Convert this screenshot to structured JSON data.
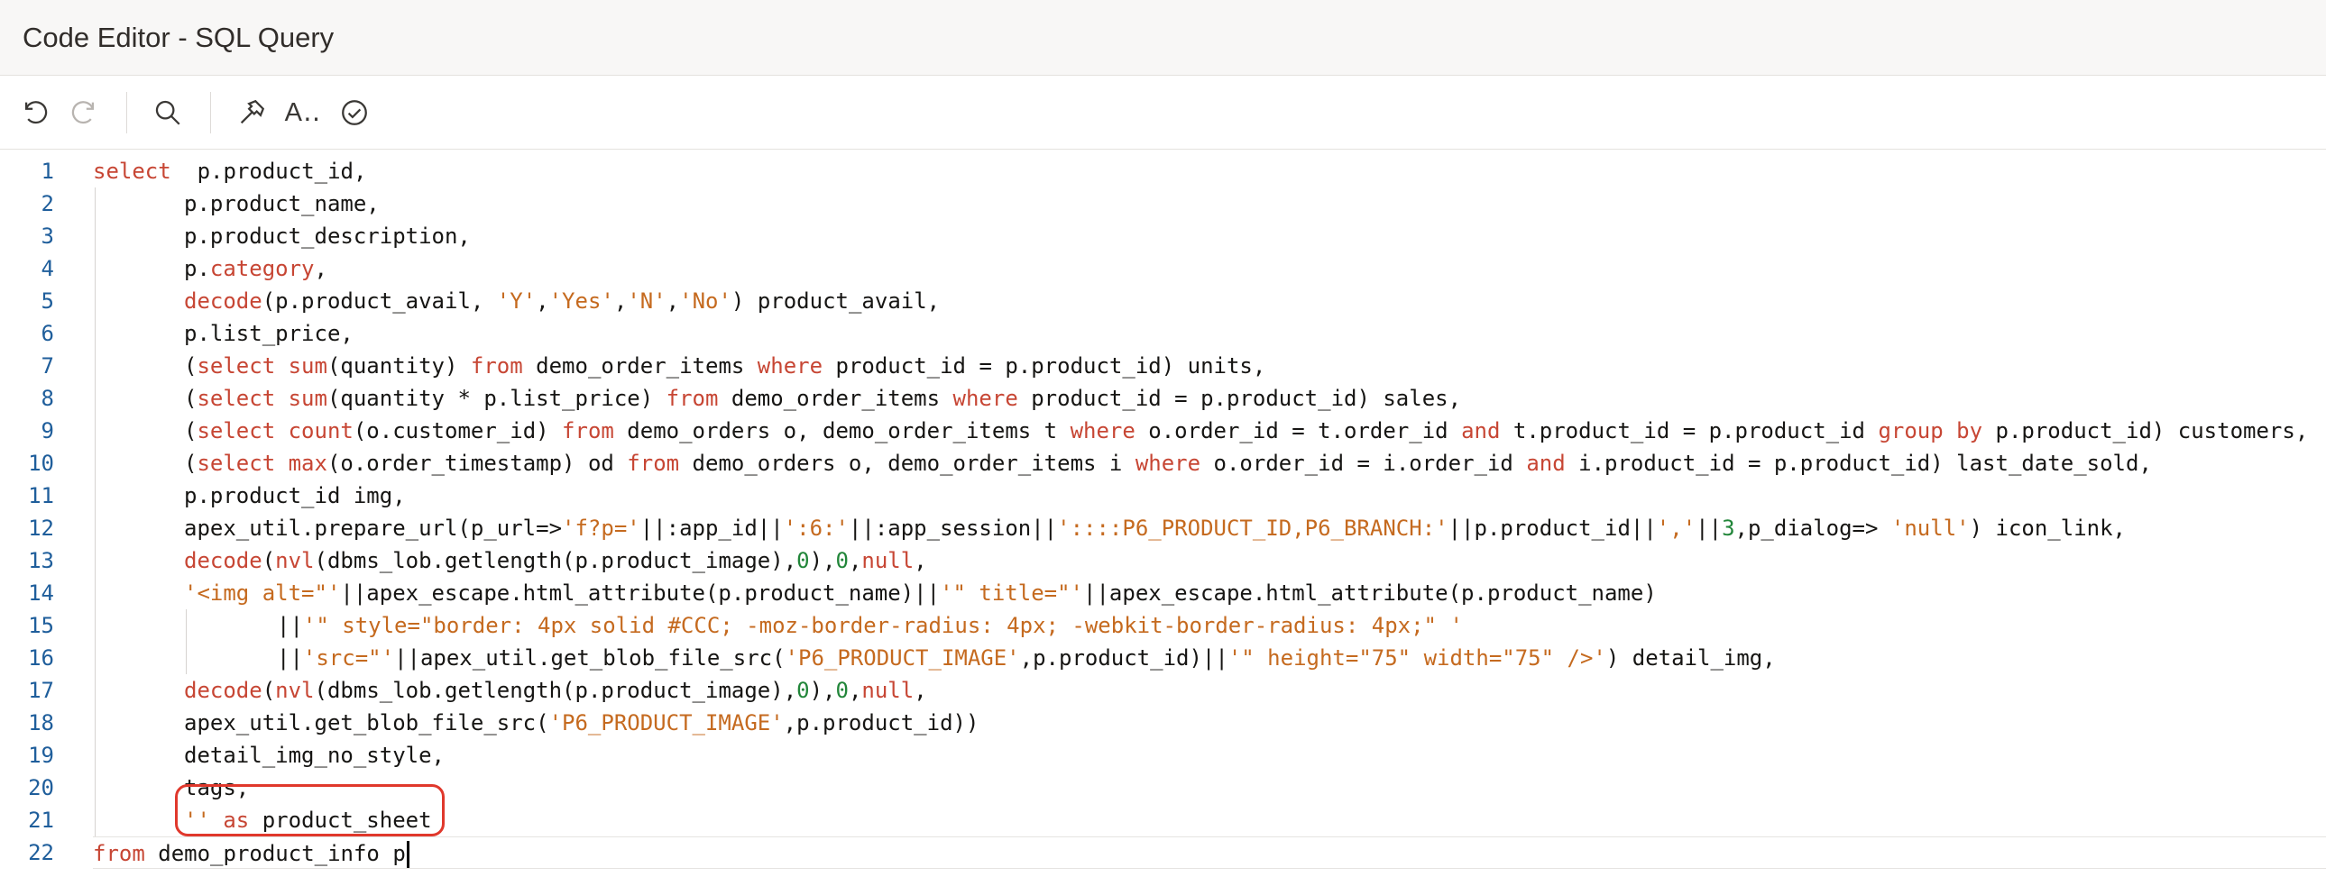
{
  "window": {
    "title": "Code Editor - SQL Query"
  },
  "toolbar": {
    "undo": "undo-icon",
    "redo": "redo-icon",
    "search": "search-icon",
    "settings": "hammer-icon",
    "autocomplete_label": "A‥",
    "validate": "check-circle-icon"
  },
  "highlight_color": "#e0382c",
  "colors": {
    "keyword": "#c74634",
    "string": "#c56a1f",
    "number": "#22863a",
    "line_number": "#1f5e9b"
  },
  "editor": {
    "line_numbers": [
      "1",
      "2",
      "3",
      "4",
      "5",
      "6",
      "7",
      "8",
      "9",
      "10",
      "11",
      "12",
      "13",
      "14",
      "15",
      "16",
      "17",
      "18",
      "19",
      "20",
      "21",
      "22"
    ],
    "lines": [
      {
        "indent": 0,
        "tokens": [
          [
            "kw",
            "select"
          ],
          [
            "",
            "  p.product_id,"
          ]
        ]
      },
      {
        "indent": 1,
        "tokens": [
          [
            "",
            "p.product_name,"
          ]
        ]
      },
      {
        "indent": 1,
        "tokens": [
          [
            "",
            "p.product_description,"
          ]
        ]
      },
      {
        "indent": 1,
        "tokens": [
          [
            "",
            "p."
          ],
          [
            "kw",
            "category"
          ],
          [
            "",
            ","
          ]
        ]
      },
      {
        "indent": 1,
        "tokens": [
          [
            "kw",
            "decode"
          ],
          [
            "",
            "(p.product_avail, "
          ],
          [
            "str",
            "'Y'"
          ],
          [
            "",
            ","
          ],
          [
            "str",
            "'Yes'"
          ],
          [
            "",
            ","
          ],
          [
            "str",
            "'N'"
          ],
          [
            "",
            ","
          ],
          [
            "str",
            "'No'"
          ],
          [
            "",
            ") product_avail,"
          ]
        ]
      },
      {
        "indent": 1,
        "tokens": [
          [
            "",
            "p.list_price,"
          ]
        ]
      },
      {
        "indent": 1,
        "tokens": [
          [
            "",
            "("
          ],
          [
            "kw",
            "select"
          ],
          [
            "kw",
            " sum"
          ],
          [
            "",
            "(quantity) "
          ],
          [
            "kw",
            "from"
          ],
          [
            "",
            " demo_order_items "
          ],
          [
            "kw",
            "where"
          ],
          [
            "",
            " product_id = p.product_id) units,"
          ]
        ]
      },
      {
        "indent": 1,
        "tokens": [
          [
            "",
            "("
          ],
          [
            "kw",
            "select"
          ],
          [
            "kw",
            " sum"
          ],
          [
            "",
            "(quantity * p.list_price) "
          ],
          [
            "kw",
            "from"
          ],
          [
            "",
            " demo_order_items "
          ],
          [
            "kw",
            "where"
          ],
          [
            "",
            " product_id = p.product_id) sales,"
          ]
        ]
      },
      {
        "indent": 1,
        "tokens": [
          [
            "",
            "("
          ],
          [
            "kw",
            "select"
          ],
          [
            "kw",
            " count"
          ],
          [
            "",
            "(o.customer_id) "
          ],
          [
            "kw",
            "from"
          ],
          [
            "",
            " demo_orders o, demo_order_items t "
          ],
          [
            "kw",
            "where"
          ],
          [
            "",
            " o.order_id = t.order_id "
          ],
          [
            "kw",
            "and"
          ],
          [
            "",
            " t.product_id = p.product_id "
          ],
          [
            "kw",
            "group by"
          ],
          [
            "",
            " p.product_id) customers,"
          ]
        ]
      },
      {
        "indent": 1,
        "tokens": [
          [
            "",
            "("
          ],
          [
            "kw",
            "select"
          ],
          [
            "kw",
            " max"
          ],
          [
            "",
            "(o.order_timestamp) od "
          ],
          [
            "kw",
            "from"
          ],
          [
            "",
            " demo_orders o, demo_order_items i "
          ],
          [
            "kw",
            "where"
          ],
          [
            "",
            " o.order_id = i.order_id "
          ],
          [
            "kw",
            "and"
          ],
          [
            "",
            " i.product_id = p.product_id) last_date_sold,"
          ]
        ]
      },
      {
        "indent": 1,
        "tokens": [
          [
            "",
            "p.product_id img,"
          ]
        ]
      },
      {
        "indent": 1,
        "tokens": [
          [
            "",
            "apex_util.prepare_url(p_url=>"
          ],
          [
            "str",
            "'f?p='"
          ],
          [
            "",
            "||:app_id||"
          ],
          [
            "str",
            "':6:'"
          ],
          [
            "",
            "||:app_session||"
          ],
          [
            "str",
            "'::::P6_PRODUCT_ID,P6_BRANCH:'"
          ],
          [
            "",
            "||p.product_id||"
          ],
          [
            "str",
            "','"
          ],
          [
            "",
            "||"
          ],
          [
            "num",
            "3"
          ],
          [
            "",
            ",p_dialog=> "
          ],
          [
            "str",
            "'null'"
          ],
          [
            "",
            ") icon_link,"
          ]
        ]
      },
      {
        "indent": 1,
        "tokens": [
          [
            "kw",
            "decode"
          ],
          [
            "",
            "("
          ],
          [
            "kw",
            "nvl"
          ],
          [
            "",
            "(dbms_lob.getlength(p.product_image),"
          ],
          [
            "num",
            "0"
          ],
          [
            "",
            "),"
          ],
          [
            "num",
            "0"
          ],
          [
            "",
            ","
          ],
          [
            "kw",
            "null"
          ],
          [
            "",
            ","
          ]
        ]
      },
      {
        "indent": 1,
        "tokens": [
          [
            "str",
            "'<img alt=\"'"
          ],
          [
            "",
            "||apex_escape.html_attribute(p.product_name)||"
          ],
          [
            "str",
            "'\" title=\"'"
          ],
          [
            "",
            "||apex_escape.html_attribute(p.product_name)"
          ]
        ]
      },
      {
        "indent": 2,
        "tokens": [
          [
            "",
            "||"
          ],
          [
            "str",
            "'\" style=\"border: 4px solid #CCC; -moz-border-radius: 4px; -webkit-border-radius: 4px;\" '"
          ]
        ]
      },
      {
        "indent": 2,
        "tokens": [
          [
            "",
            "||"
          ],
          [
            "str",
            "'src=\"'"
          ],
          [
            "",
            "||apex_util.get_blob_file_src("
          ],
          [
            "str",
            "'P6_PRODUCT_IMAGE'"
          ],
          [
            "",
            ",p.product_id)||"
          ],
          [
            "str",
            "'\" height=\"75\" width=\"75\" />'"
          ],
          [
            "",
            ") detail_img,"
          ]
        ]
      },
      {
        "indent": 1,
        "tokens": [
          [
            "kw",
            "decode"
          ],
          [
            "",
            "("
          ],
          [
            "kw",
            "nvl"
          ],
          [
            "",
            "(dbms_lob.getlength(p.product_image),"
          ],
          [
            "num",
            "0"
          ],
          [
            "",
            "),"
          ],
          [
            "num",
            "0"
          ],
          [
            "",
            ","
          ],
          [
            "kw",
            "null"
          ],
          [
            "",
            ","
          ]
        ]
      },
      {
        "indent": 1,
        "tokens": [
          [
            "",
            "apex_util.get_blob_file_src("
          ],
          [
            "str",
            "'P6_PRODUCT_IMAGE'"
          ],
          [
            "",
            ",p.product_id))"
          ]
        ]
      },
      {
        "indent": 1,
        "tokens": [
          [
            "",
            "detail_img_no_style,"
          ]
        ]
      },
      {
        "indent": 1,
        "tokens": [
          [
            "",
            "tags,"
          ]
        ]
      },
      {
        "indent": 1,
        "tokens": [
          [
            "str",
            "''"
          ],
          [
            "kw",
            " as"
          ],
          [
            "",
            " product_sheet"
          ]
        ]
      },
      {
        "indent": 0,
        "tokens": [
          [
            "kw",
            "from"
          ],
          [
            "",
            " demo_product_info p"
          ]
        ]
      }
    ]
  }
}
